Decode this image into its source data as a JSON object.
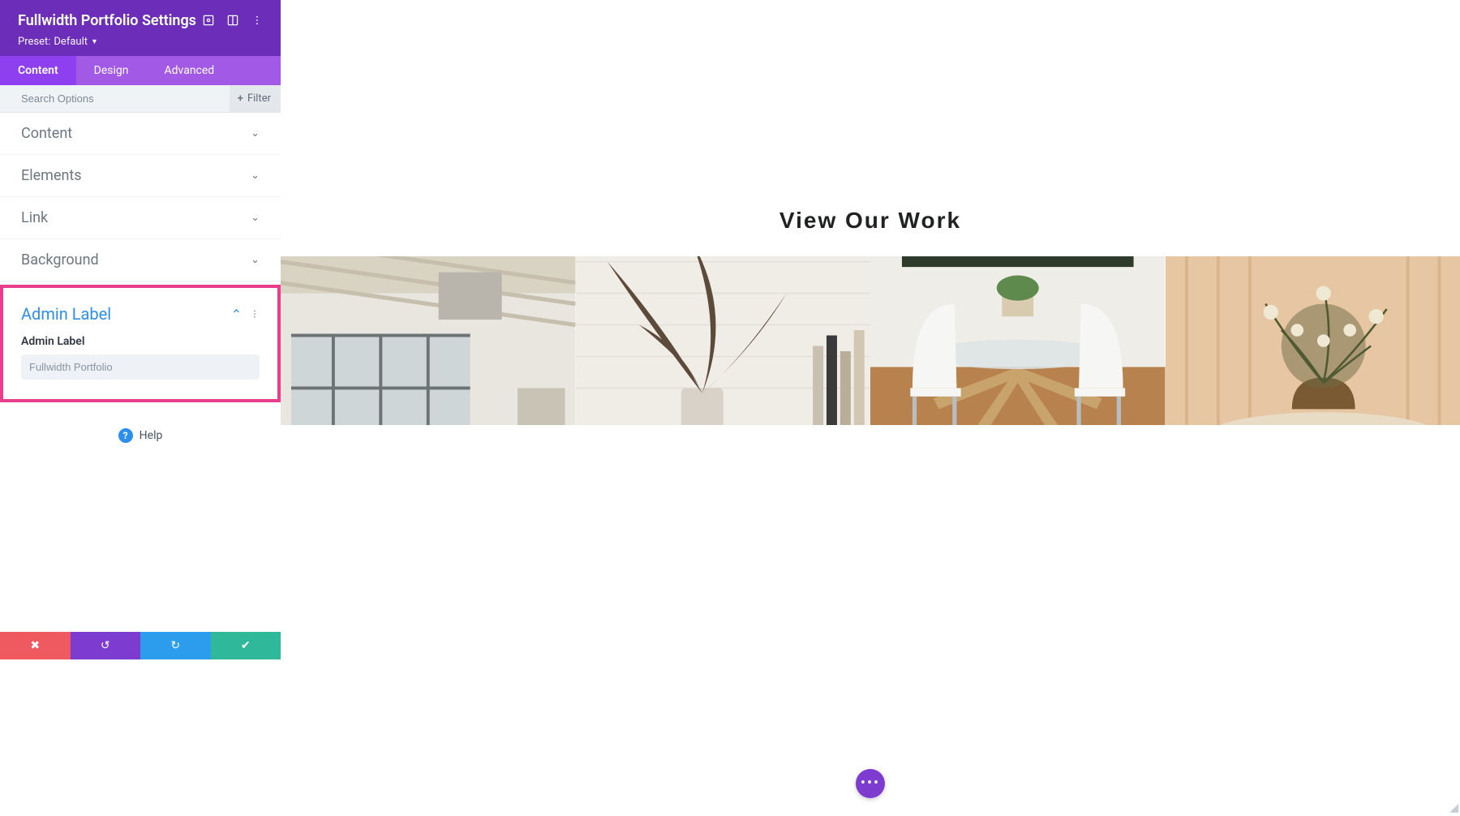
{
  "panel": {
    "title": "Fullwidth Portfolio Settings",
    "preset_prefix": "Preset:",
    "preset_value": "Default",
    "tabs": [
      "Content",
      "Design",
      "Advanced"
    ],
    "active_tab_index": 0,
    "search_placeholder": "Search Options",
    "filter_label": "Filter",
    "sections": [
      {
        "label": "Content"
      },
      {
        "label": "Elements"
      },
      {
        "label": "Link"
      },
      {
        "label": "Background"
      }
    ],
    "admin_label": {
      "title": "Admin Label",
      "field_label": "Admin Label",
      "value": "Fullwidth Portfolio"
    },
    "help_label": "Help"
  },
  "preview": {
    "title": "View Our Work"
  },
  "colors": {
    "brand_purple_dark": "#6c2eb9",
    "brand_purple": "#8e3ff0",
    "brand_purple_light": "#a259e6",
    "highlight_pink": "#e83e8c",
    "link_blue": "#2d8feb",
    "footer_red": "#ef5a61",
    "footer_blue": "#2c9ced",
    "footer_green": "#2fb89a"
  },
  "icons": {
    "responsive": "responsive-icon",
    "columns": "columns-icon",
    "more": "more-vertical-icon",
    "chevron_down": "chevron-down-icon",
    "chevron_up": "chevron-up-icon",
    "plus": "plus-icon",
    "help": "help-icon",
    "close_x": "close-icon",
    "undo": "undo-icon",
    "redo": "redo-icon",
    "check": "check-icon",
    "dots": "dots-icon"
  }
}
